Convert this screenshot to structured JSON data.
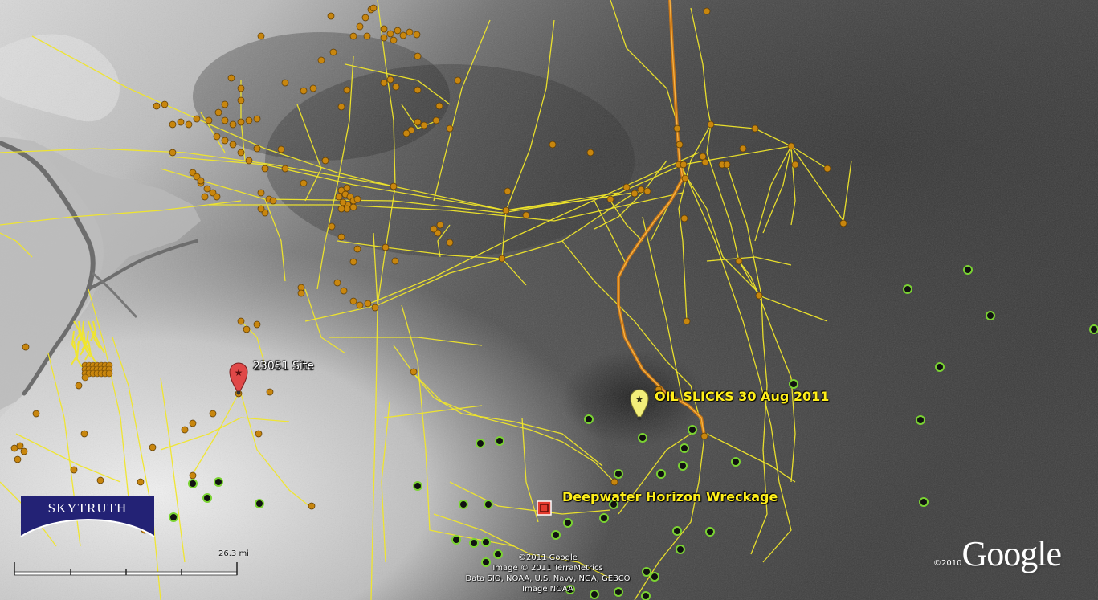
{
  "placemarks": {
    "site_23051": {
      "label": "23051 Site"
    },
    "oil_slicks": {
      "label": "OIL SLICKS 30 Aug 2011"
    },
    "wreckage": {
      "label": "Deepwater Horizon Wreckage"
    }
  },
  "attribution": {
    "line1": "©2011 Google",
    "line2": "Image © 2011 TerraMetrics",
    "line3": "Data SIO, NOAA, U.S. Navy, NGA, GEBCO",
    "line4": "Image NOAA"
  },
  "google": {
    "year": "©2010",
    "word": "Google"
  },
  "skytruth": {
    "text": "SKYTRUTH"
  },
  "scale": {
    "label": "26.3 mi"
  },
  "colors": {
    "pipeline": "#f0e62a",
    "platform": "#c8860e",
    "main_pipeline": "#e8890c",
    "green_marker": "#7ad332",
    "wreckage_marker": "#e33b2e",
    "slick_pin": "#f2ee7a",
    "site_pin": "#e04848"
  }
}
